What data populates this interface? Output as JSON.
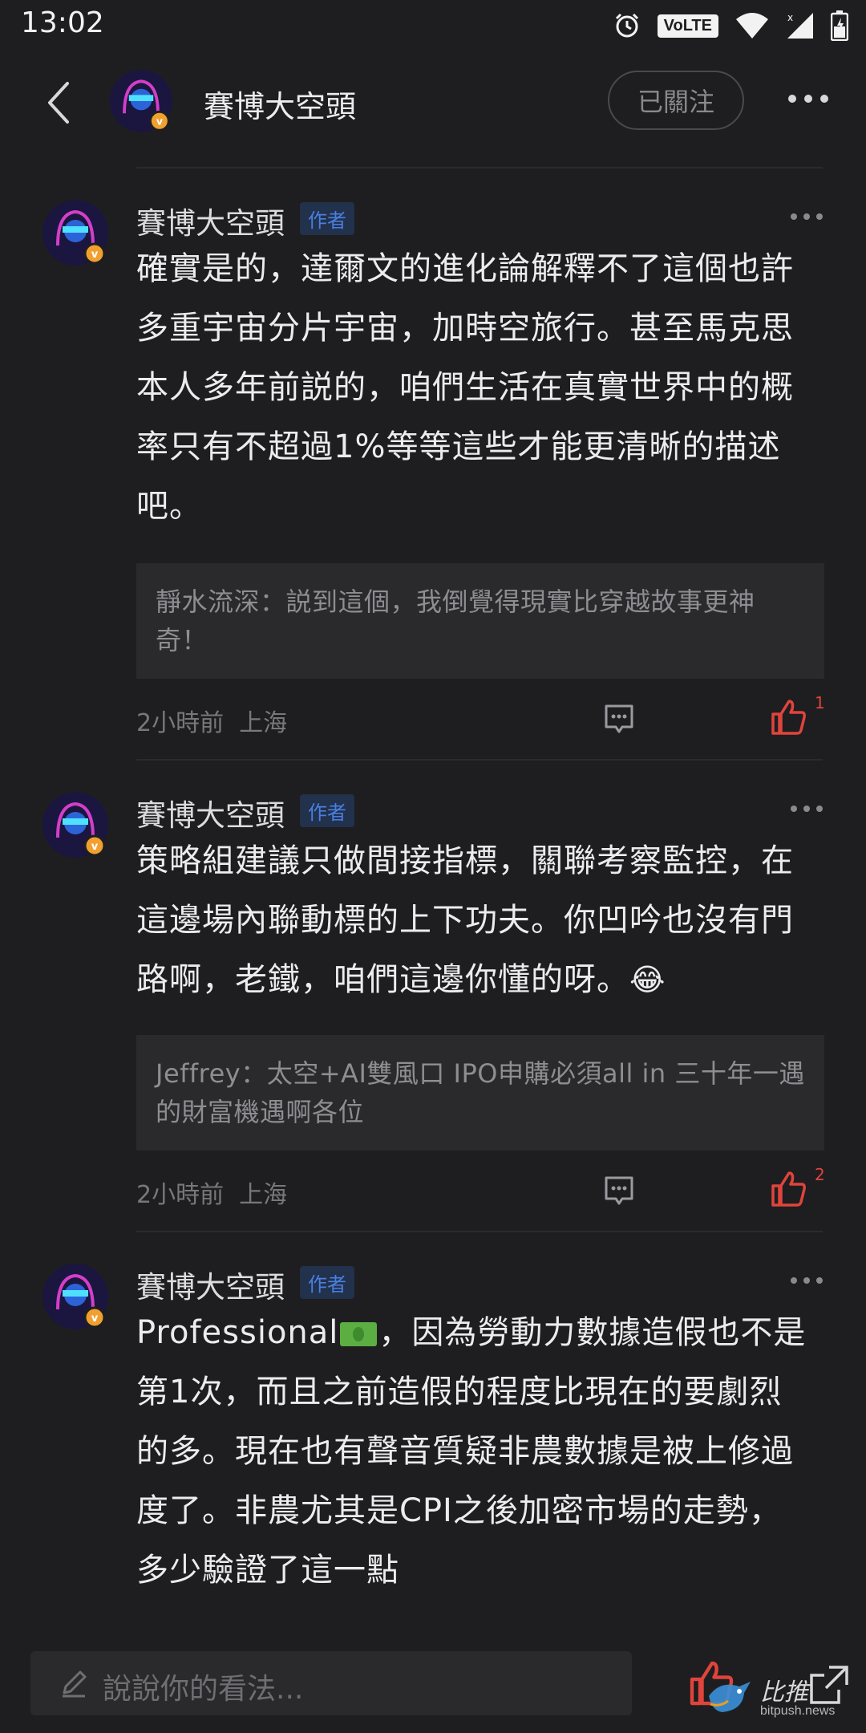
{
  "status_bar": {
    "time": "13:02",
    "network_badge": "VoLTE"
  },
  "header": {
    "user_name": "賽博大空頭",
    "follow_label": "已關注"
  },
  "comments": [
    {
      "name": "賽博大空頭",
      "badge": "作者",
      "lines": [
        "確實是的，達爾文的進化論解釋不了這個也許",
        "多重宇宙分片宇宙，加時空旅行。甚至馬克思",
        "本人多年前説的，咱們生活在真實世界中的概",
        "率只有不超過1%等等這些才能更清晰的描述",
        "吧。"
      ],
      "quote": "靜水流深：説到這個，我倒覺得現實比穿越故事更神奇！",
      "time": "2小時前",
      "location": "上海",
      "likes": "1"
    },
    {
      "name": "賽博大空頭",
      "badge": "作者",
      "lines": [
        "策略組建議只做間接指標，關聯考察監控，在",
        "這邊場內聯動標的上下功夫。你凹吟也沒有門",
        "路啊，老鐵，咱們這邊你懂的呀。"
      ],
      "emoji": "😂",
      "quote": "Jeffrey：太空+AI雙風口 IPO申購必須all in 三十年一遇的財富機遇啊各位",
      "time": "2小時前",
      "location": "上海",
      "likes": "2"
    },
    {
      "name": "賽博大空頭",
      "badge": "作者",
      "first_word": "Professional",
      "first_rest": "，因為勞動力數據造假也不是",
      "lines": [
        "第1次，而且之前造假的程度比現在的要劇烈",
        "的多。現在也有聲音質疑非農數據是被上修過",
        "度了。非農尤其是CPI之後加密市場的走勢，",
        "多少驗證了這一點"
      ]
    }
  ],
  "bottom_bar": {
    "input_placeholder": "說說你的看法...",
    "watermark_name": "比推",
    "watermark_domain": "bitpush.news"
  },
  "colors": {
    "background": "#1e1e20",
    "like_red": "#e0443c",
    "author_badge": "#4a7fe0"
  },
  "icons": [
    "back-arrow-icon",
    "more-dots-icon",
    "reply-icon",
    "thumbs-up-icon",
    "pen-icon",
    "share-icon",
    "money-emoji-icon",
    "laughing-emoji-icon"
  ]
}
